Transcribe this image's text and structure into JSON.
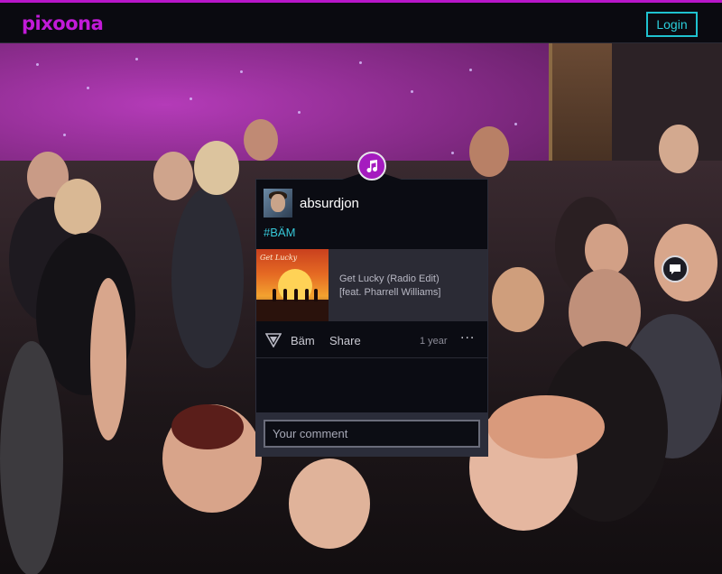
{
  "header": {
    "logo": "pixoona",
    "login_label": "Login"
  },
  "post": {
    "username": "absurdjon",
    "hashtag": "#BÄM",
    "track": {
      "title_line1": "Get Lucky (Radio Edit)",
      "title_line2": "[feat. Pharrell Williams]",
      "cover_text": "Get Lucky"
    },
    "actions": {
      "bam_label": "Bäm",
      "share_label": "Share",
      "age": "1 year",
      "more": "···"
    },
    "comment": {
      "placeholder": "Your comment"
    },
    "badge_icon": "music-note-icon"
  },
  "colors": {
    "brand": "#c21ad8",
    "accent": "#36c6d6",
    "panel": "#0b0c13"
  }
}
